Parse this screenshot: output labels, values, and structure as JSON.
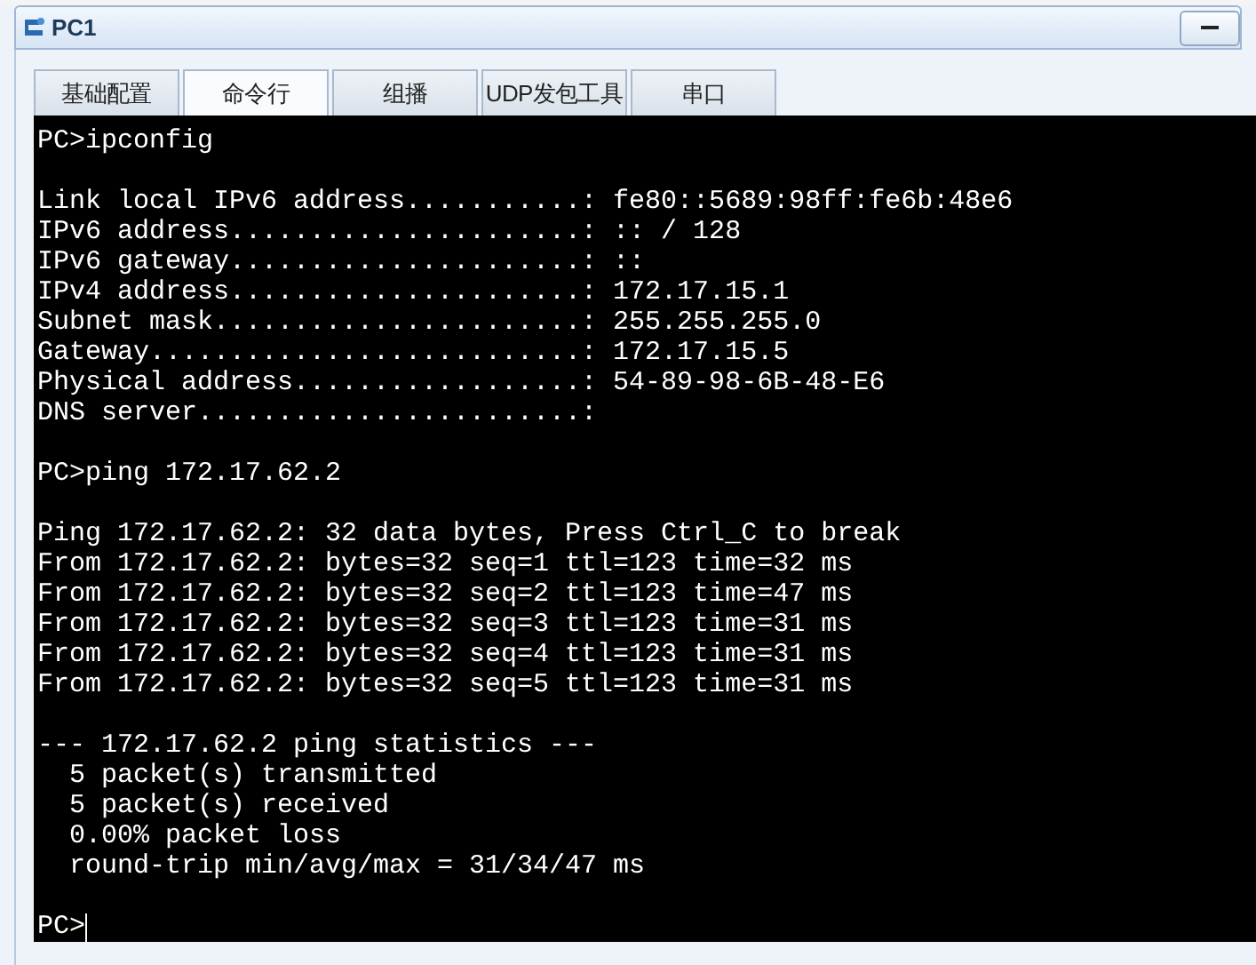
{
  "window": {
    "title": "PC1"
  },
  "tabs": [
    {
      "label": "基础配置",
      "selected": false
    },
    {
      "label": "命令行",
      "selected": true
    },
    {
      "label": "组播",
      "selected": false
    },
    {
      "label": "UDP发包工具",
      "selected": false
    },
    {
      "label": "串口",
      "selected": false
    }
  ],
  "terminal": {
    "blocks": [
      [
        "PC>ipconfig"
      ],
      [
        "Link local IPv6 address...........: fe80::5689:98ff:fe6b:48e6",
        "IPv6 address......................: :: / 128",
        "IPv6 gateway......................: ::",
        "IPv4 address......................: 172.17.15.1",
        "Subnet mask.......................: 255.255.255.0",
        "Gateway...........................: 172.17.15.5",
        "Physical address..................: 54-89-98-6B-48-E6",
        "DNS server........................:"
      ],
      [
        "PC>ping 172.17.62.2"
      ],
      [
        "Ping 172.17.62.2: 32 data bytes, Press Ctrl_C to break",
        "From 172.17.62.2: bytes=32 seq=1 ttl=123 time=32 ms",
        "From 172.17.62.2: bytes=32 seq=2 ttl=123 time=47 ms",
        "From 172.17.62.2: bytes=32 seq=3 ttl=123 time=31 ms",
        "From 172.17.62.2: bytes=32 seq=4 ttl=123 time=31 ms",
        "From 172.17.62.2: bytes=32 seq=5 ttl=123 time=31 ms"
      ],
      [
        "--- 172.17.62.2 ping statistics ---",
        "  5 packet(s) transmitted",
        "  5 packet(s) received",
        "  0.00% packet loss",
        "  round-trip min/avg/max = 31/34/47 ms"
      ]
    ],
    "prompt": "PC>"
  }
}
